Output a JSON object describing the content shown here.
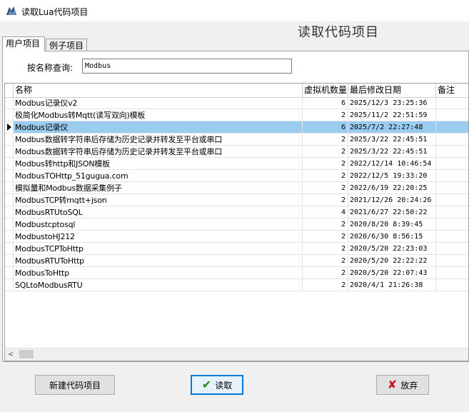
{
  "window": {
    "title": "读取Lua代码项目",
    "icon": "app-logo-icon"
  },
  "header": {
    "title": "读取代码项目"
  },
  "tabs": [
    {
      "label": "用户项目",
      "active": true
    },
    {
      "label": "例子项目",
      "active": false
    }
  ],
  "search": {
    "label": "按名称查询:",
    "value": "Modbus"
  },
  "table": {
    "columns": [
      "名称",
      "虚拟机数量",
      "最后修改日期",
      "备注"
    ],
    "rows": [
      {
        "name": "Modbus记录仪v2",
        "vm": "6",
        "date": "2025/12/3 23:25:36",
        "note": "",
        "selected": false
      },
      {
        "name": "极简化Modbus转Mqtt(读写双向)模板",
        "vm": "2",
        "date": "2025/11/2 22:51:59",
        "note": "",
        "selected": false
      },
      {
        "name": "Modbus记录仪",
        "vm": "6",
        "date": "2025/7/2 22:27:48",
        "note": "",
        "selected": true
      },
      {
        "name": "Modbus数据转字符串后存储为历史记录并转发至平台或串口",
        "vm": "2",
        "date": "2025/3/22 22:45:51",
        "note": "",
        "selected": false
      },
      {
        "name": "Modbus数据转字符串后存储为历史记录并转发至平台或串口",
        "vm": "2",
        "date": "2025/3/22 22:45:51",
        "note": "",
        "selected": false
      },
      {
        "name": "Modbus转http和JSON模板",
        "vm": "2",
        "date": "2022/12/14 10:46:54",
        "note": "",
        "selected": false
      },
      {
        "name": "ModbusTOHttp_51gugua.com",
        "vm": "2",
        "date": "2022/12/5 19:33:20",
        "note": "",
        "selected": false
      },
      {
        "name": "模拟量和Modbus数据采集例子",
        "vm": "2",
        "date": "2022/6/19 22:20:25",
        "note": "",
        "selected": false
      },
      {
        "name": "ModbusTCP转mqtt+json",
        "vm": "2",
        "date": "2021/12/26 20:24:26",
        "note": "",
        "selected": false
      },
      {
        "name": "ModbusRTUtoSQL",
        "vm": "4",
        "date": "2021/6/27 22:50:22",
        "note": "",
        "selected": false
      },
      {
        "name": "Modbustcptosql",
        "vm": "2",
        "date": "2020/8/20 8:39:45",
        "note": "",
        "selected": false
      },
      {
        "name": "ModbustoHJ212",
        "vm": "2",
        "date": "2020/6/30 8:56:15",
        "note": "",
        "selected": false
      },
      {
        "name": "ModbusTCPToHttp",
        "vm": "2",
        "date": "2020/5/20 22:23:03",
        "note": "",
        "selected": false
      },
      {
        "name": "ModbusRTUToHttp",
        "vm": "2",
        "date": "2020/5/20 22:22:22",
        "note": "",
        "selected": false
      },
      {
        "name": "ModbusToHttp",
        "vm": "2",
        "date": "2020/5/20 22:07:43",
        "note": "",
        "selected": false
      },
      {
        "name": "SQLtoModbusRTU",
        "vm": "2",
        "date": "2020/4/1 21:26:38",
        "note": "",
        "selected": false
      }
    ]
  },
  "buttons": {
    "new_label": "新建代码项目",
    "read_label": "读取",
    "cancel_label": "放弃"
  },
  "colors": {
    "selection": "#99ccee",
    "focus_border": "#0078d7",
    "check": "#1c8a1c",
    "cancel_x": "#c8102e"
  }
}
